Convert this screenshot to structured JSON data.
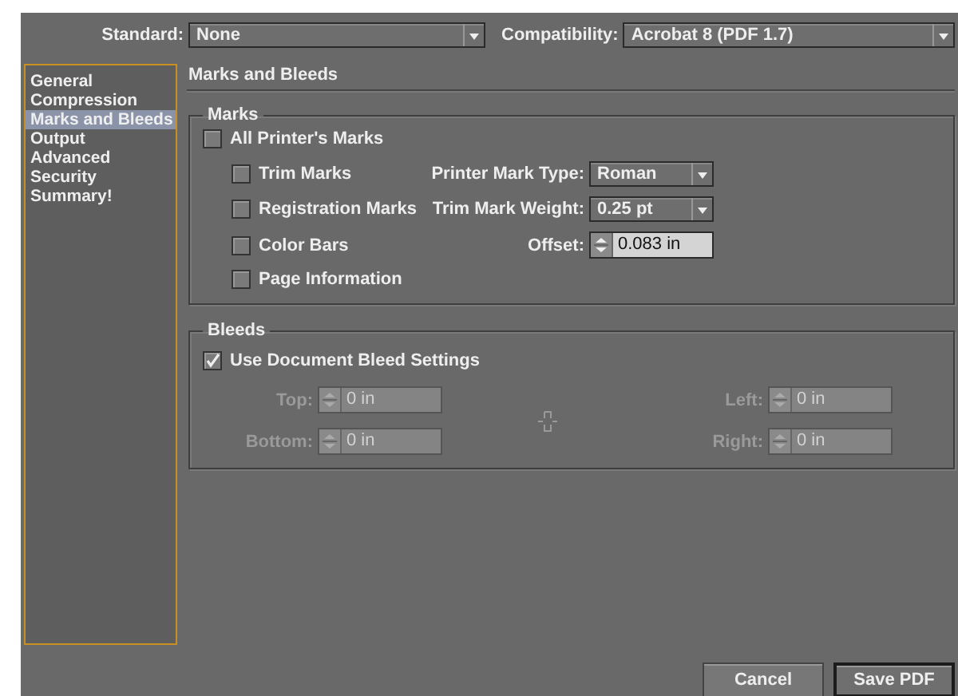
{
  "standard": {
    "label": "Standard:",
    "value": "None"
  },
  "compatibility": {
    "label": "Compatibility:",
    "value": "Acrobat 8 (PDF 1.7)"
  },
  "sidebar": {
    "items": [
      {
        "label": "General",
        "selected": false
      },
      {
        "label": "Compression",
        "selected": false
      },
      {
        "label": "Marks and Bleeds",
        "selected": true
      },
      {
        "label": "Output",
        "selected": false
      },
      {
        "label": "Advanced",
        "selected": false
      },
      {
        "label": "Security",
        "selected": false
      },
      {
        "label": "Summary!",
        "selected": false
      }
    ]
  },
  "section_title": "Marks and Bleeds",
  "marks": {
    "title": "Marks",
    "all_printers_marks": {
      "label": "All Printer's Marks",
      "checked": false
    },
    "options": [
      {
        "label": "Trim Marks",
        "checked": false
      },
      {
        "label": "Registration Marks",
        "checked": false
      },
      {
        "label": "Color Bars",
        "checked": false
      },
      {
        "label": "Page Information",
        "checked": false
      }
    ],
    "printer_mark_type": {
      "label": "Printer Mark Type:",
      "value": "Roman"
    },
    "trim_mark_weight": {
      "label": "Trim Mark Weight:",
      "value": "0.25 pt"
    },
    "offset": {
      "label": "Offset:",
      "value": "0.083 in",
      "disabled": false
    }
  },
  "bleeds": {
    "title": "Bleeds",
    "use_document": {
      "label": "Use Document Bleed Settings",
      "checked": true
    },
    "fields": [
      {
        "label": "Top:",
        "value": "0 in",
        "disabled": true
      },
      {
        "label": "Left:",
        "value": "0 in",
        "disabled": true
      },
      {
        "label": "Bottom:",
        "value": "0 in",
        "disabled": true
      },
      {
        "label": "Right:",
        "value": "0 in",
        "disabled": true
      }
    ]
  },
  "buttons": [
    {
      "label": "Cancel",
      "kind": "normal"
    },
    {
      "label": "Save PDF",
      "kind": "default"
    }
  ]
}
